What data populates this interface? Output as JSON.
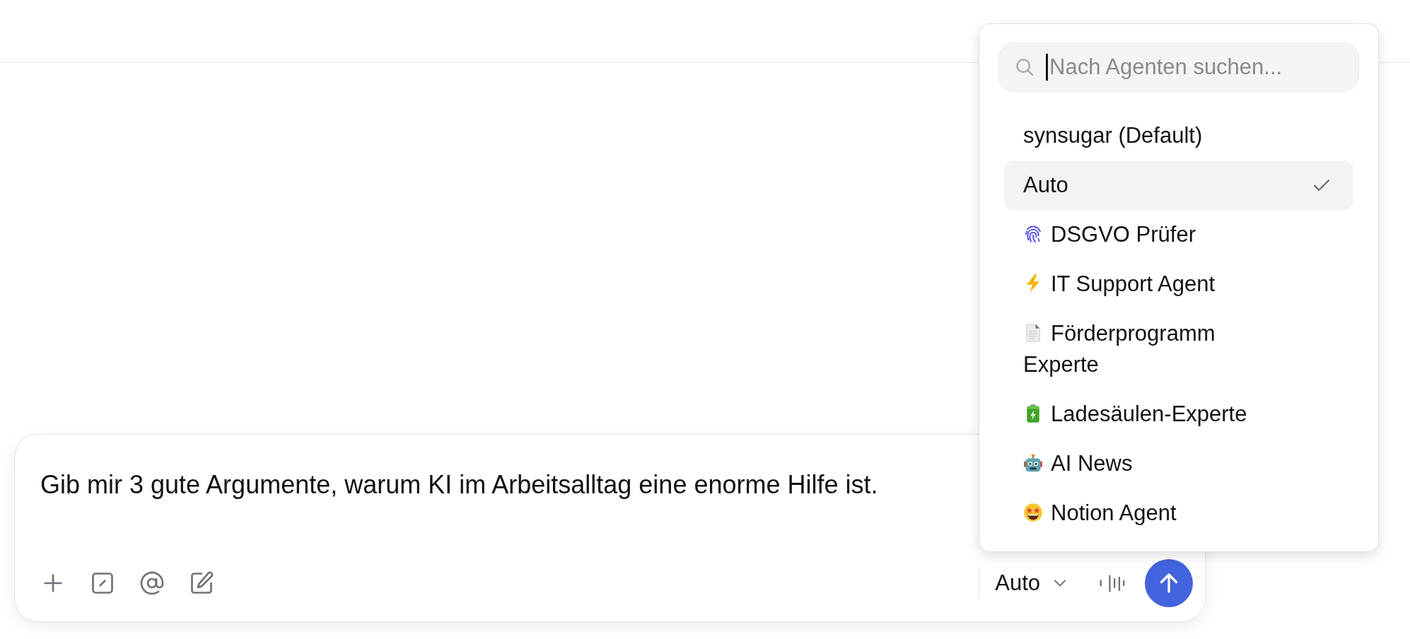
{
  "agent_menu": {
    "search": {
      "placeholder": "Nach Agenten suchen...",
      "focused": true
    },
    "items": [
      {
        "label": "synsugar (Default)",
        "kind": "plain",
        "selected": false
      },
      {
        "label": "Auto",
        "kind": "plain",
        "selected": true
      },
      {
        "label": "DSGVO Prüfer",
        "kind": "fingerprint",
        "selected": false
      },
      {
        "label": "IT Support Agent",
        "kind": "lightning",
        "selected": false
      },
      {
        "label": "Förderprogramm Experte",
        "kind": "document",
        "selected": false
      },
      {
        "label": "Ladesäulen-Experte",
        "kind": "battery",
        "selected": false
      },
      {
        "label": "AI News",
        "kind": "robot",
        "selected": false
      },
      {
        "label": "Notion Agent",
        "kind": "starface",
        "selected": false
      }
    ]
  },
  "composer": {
    "value": "Gib mir 3 gute Argumente, warum KI im Arbeitsalltag eine enorme Hilfe ist.",
    "agent_selector": {
      "label": "Auto"
    }
  }
}
